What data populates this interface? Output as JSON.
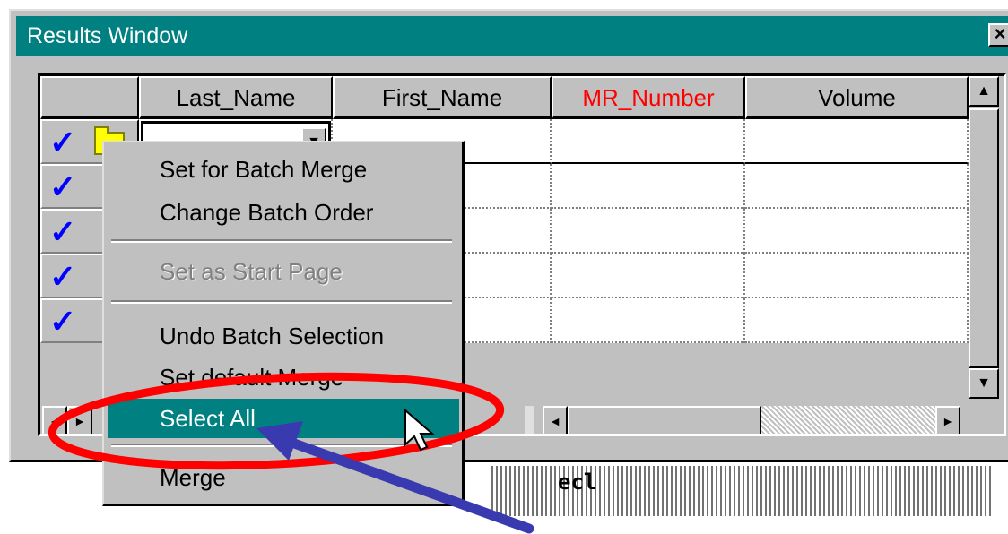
{
  "window": {
    "title": "Results Window",
    "close_label": "×"
  },
  "grid": {
    "columns": [
      "",
      "Last_Name",
      "First_Name",
      "MR_Number",
      "Volume"
    ],
    "highlight_color": "#ff0000",
    "rows_checked": 5,
    "check_glyph": "✓",
    "combo_arrow": "▼"
  },
  "scrollbar": {
    "up": "▲",
    "down": "▼",
    "left": "◄",
    "right": "►"
  },
  "context_menu": {
    "items": [
      {
        "label": "Set for Batch Merge",
        "state": "normal"
      },
      {
        "label": "Change Batch Order",
        "state": "normal"
      },
      {
        "label": "Set as Start Page",
        "state": "disabled"
      },
      {
        "label": "Undo Batch Selection",
        "state": "normal"
      },
      {
        "label": "Set default Merge",
        "state": "normal"
      },
      {
        "label": "Select All",
        "state": "selected"
      },
      {
        "label": "Merge",
        "state": "normal"
      }
    ]
  },
  "background_text": "ecl",
  "annotations": {
    "ellipse_color": "#ff0000",
    "arrow_color": "#3a3ab0"
  },
  "colors": {
    "titlebar": "#008080",
    "face": "#c0c0c0",
    "check": "#0000ff"
  }
}
